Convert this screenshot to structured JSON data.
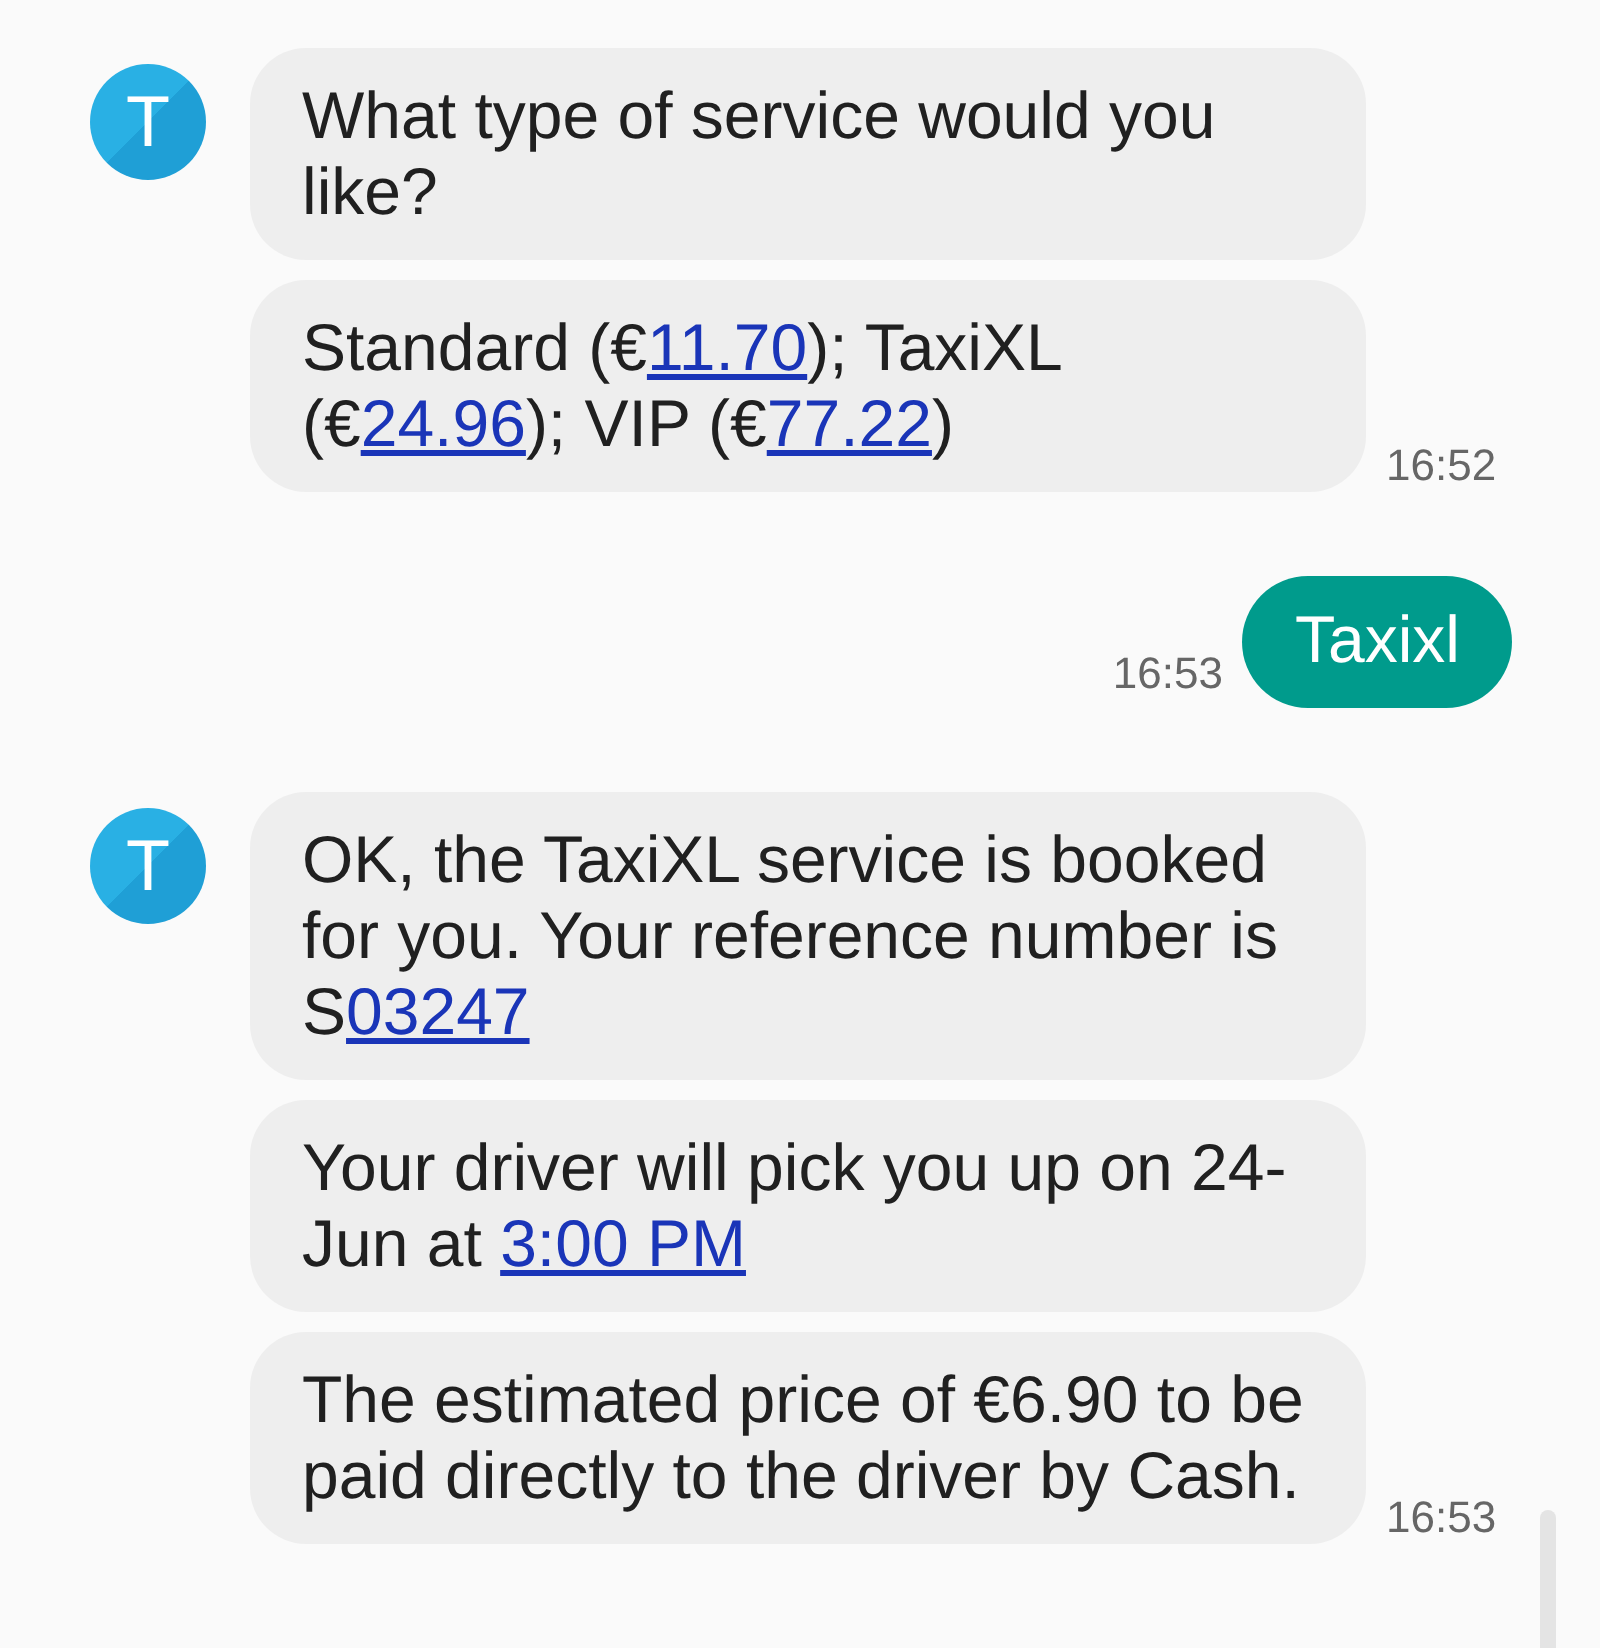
{
  "messages": [
    {
      "kind": "incoming",
      "avatar": "T",
      "time": "16:52",
      "bubbles": [
        [
          {
            "text": "What type of service would you like?",
            "link": false
          }
        ],
        [
          {
            "text": "Standard (€",
            "link": false
          },
          {
            "text": "11.70",
            "link": true
          },
          {
            "text": "); TaxiXL (€",
            "link": false
          },
          {
            "text": "24.96",
            "link": true
          },
          {
            "text": "); VIP (€",
            "link": false
          },
          {
            "text": "77.22",
            "link": true
          },
          {
            "text": ")",
            "link": false
          }
        ]
      ]
    },
    {
      "kind": "outgoing",
      "time": "16:53",
      "bubbles": [
        [
          {
            "text": "Taxixl",
            "link": false
          }
        ]
      ]
    },
    {
      "kind": "incoming",
      "avatar": "T",
      "time": "16:53",
      "bubbles": [
        [
          {
            "text": "OK, the TaxiXL service is booked for you. Your reference number is S",
            "link": false
          },
          {
            "text": "03247",
            "link": true
          }
        ],
        [
          {
            "text": "Your driver will pick you up on 24-Jun at ",
            "link": false
          },
          {
            "text": "3:00 PM",
            "link": true
          }
        ],
        [
          {
            "text": "The estimated price of €6.90 to be paid directly to the driver by Cash.",
            "link": false
          }
        ]
      ]
    }
  ]
}
